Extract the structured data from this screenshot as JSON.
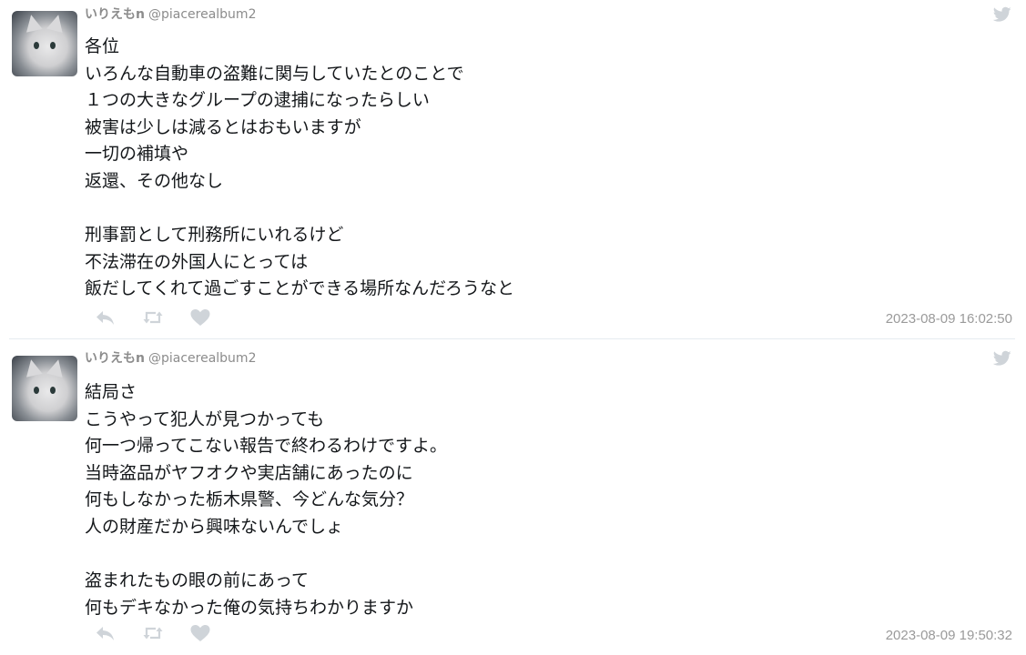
{
  "tweets": [
    {
      "author": {
        "name": "いりえもn",
        "handle": "@piacerealbum2"
      },
      "lines": [
        "各位",
        "いろんな自動車の盗難に関与していたとのことで",
        "１つの大きなグループの逮捕になったらしい",
        "被害は少しは減るとはおもいますが",
        "一切の補填や",
        "返還、その他なし",
        "",
        "刑事罰として刑務所にいれるけど",
        "不法滞在の外国人にとっては",
        "飯だしてくれて過ごすことができる場所なんだろうなと"
      ],
      "timestamp": "2023-08-09 16:02:50"
    },
    {
      "author": {
        "name": "いりえもn",
        "handle": "@piacerealbum2"
      },
      "lines": [
        "結局さ",
        "こうやって犯人が見つかっても",
        "何一つ帰ってこない報告で終わるわけですよ。",
        "当時盗品がヤフオクや実店舗にあったのに",
        "何もしなかった栃木県警、今どんな気分？",
        "人の財産だから興味ないんでしょ",
        "",
        "盗まれたもの眼の前にあって",
        "何もデキなかった俺の気持ちわかりますか"
      ],
      "timestamp": "2023-08-09 19:50:32"
    }
  ],
  "icons": {
    "bird": "twitter-bird-icon",
    "reply": "reply-icon",
    "retweet": "retweet-icon",
    "like": "heart-icon"
  },
  "colors": {
    "icon_gray": "#cfd4d9",
    "meta_gray": "#8c8c8c",
    "text": "#14171a",
    "divider": "#e6ecf0"
  }
}
